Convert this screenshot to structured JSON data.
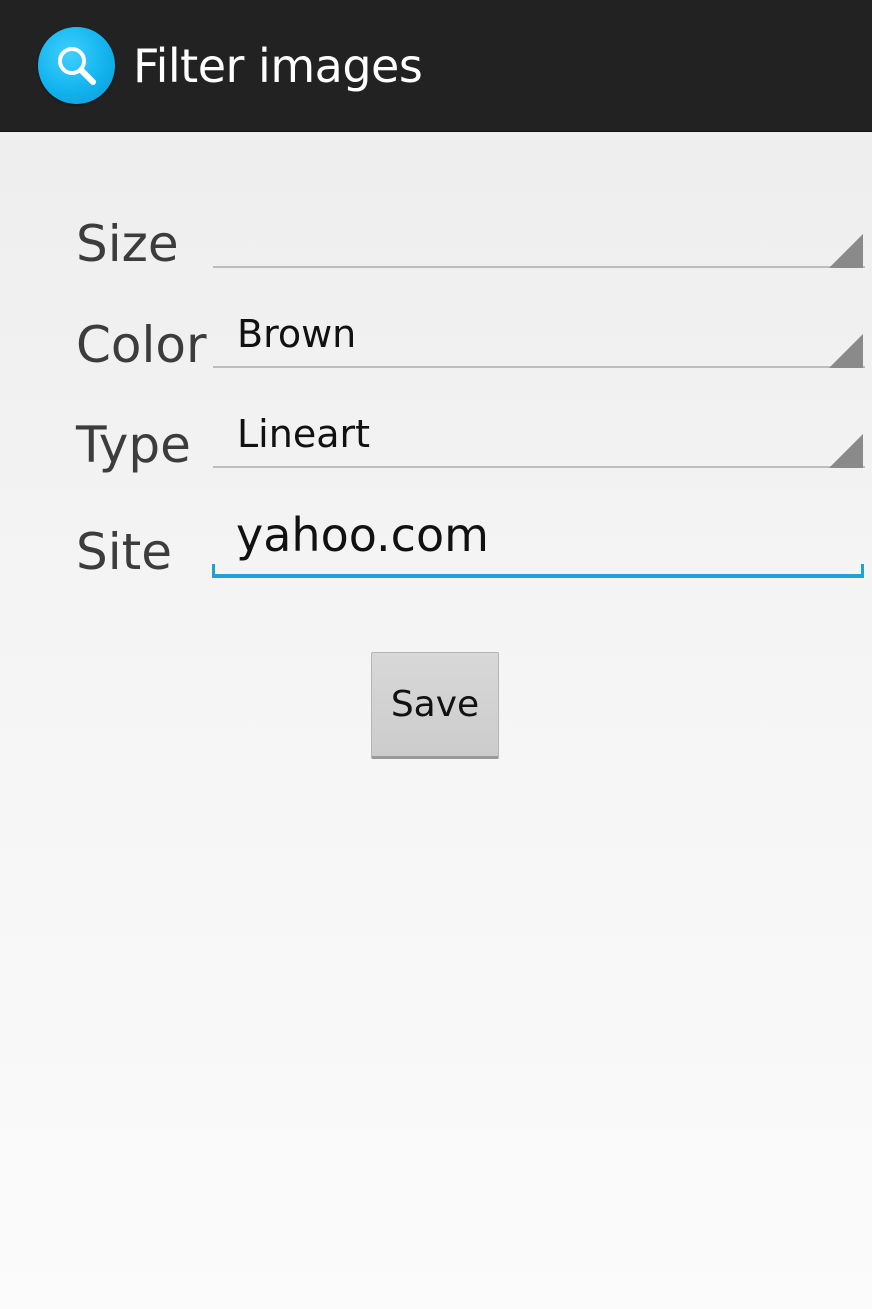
{
  "action_bar": {
    "title": "Filter images",
    "icon": "search-icon"
  },
  "form": {
    "size": {
      "label": "Size",
      "value": ""
    },
    "color": {
      "label": "Color",
      "value": "Brown"
    },
    "type": {
      "label": "Type",
      "value": "Lineart"
    },
    "site": {
      "label": "Site",
      "value": "yahoo.com"
    }
  },
  "actions": {
    "save_label": "Save"
  },
  "colors": {
    "action_bar_bg": "#222222",
    "accent": "#21a0d6",
    "icon_bg": "#12b3ee"
  }
}
